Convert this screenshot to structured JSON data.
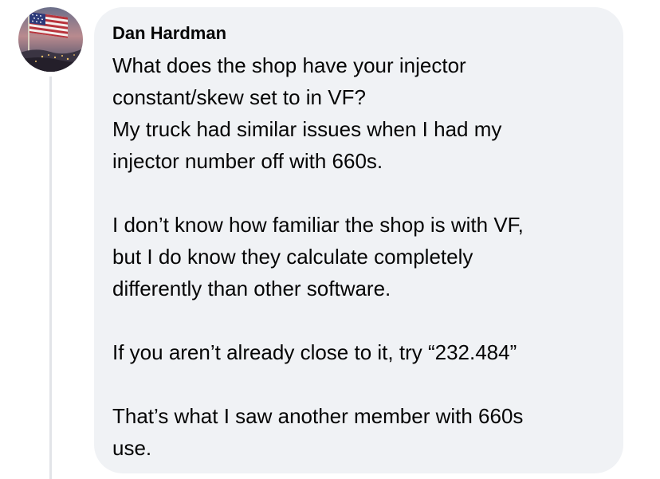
{
  "comment": {
    "author": "Dan Hardman",
    "paragraphs": [
      {
        "lines": [
          "What does the shop have your injector",
          "constant/skew set to in VF?",
          "My truck had similar issues when I had my",
          "injector number off with 660s."
        ]
      },
      {
        "lines": [
          "I don’t know how familiar the shop is with VF,",
          "but I do know they calculate completely",
          "differently than other software."
        ]
      },
      {
        "lines": [
          "If you aren’t already close to it, try “232.484”"
        ]
      },
      {
        "lines": [
          "That’s what I saw another member with 660s",
          "use."
        ]
      }
    ]
  },
  "colors": {
    "bubble_background": "#f0f2f5",
    "text": "#050505",
    "thread_line": "#e2e4e8"
  },
  "avatar": {
    "icon": "american-flag-avatar"
  }
}
